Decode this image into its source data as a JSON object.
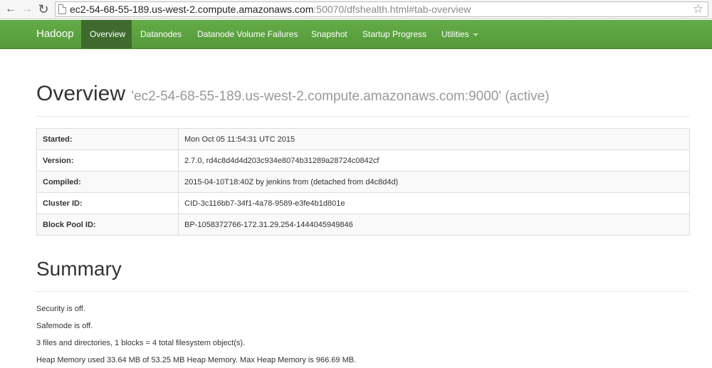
{
  "browser": {
    "url_host": "ec2-54-68-55-189.us-west-2.compute.amazonaws.com",
    "url_rest": ":50070/dfshealth.html#tab-overview"
  },
  "navbar": {
    "brand": "Hadoop",
    "items": [
      {
        "label": "Overview",
        "active": true
      },
      {
        "label": "Datanodes"
      },
      {
        "label": "Datanode Volume Failures"
      },
      {
        "label": "Snapshot"
      },
      {
        "label": "Startup Progress"
      },
      {
        "label": "Utilities"
      }
    ],
    "color": "#5da542",
    "active_color": "#3e6b2d"
  },
  "overview": {
    "title": "Overview",
    "subtitle": "'ec2-54-68-55-189.us-west-2.compute.amazonaws.com:9000' (active)",
    "rows": [
      {
        "key": "Started:",
        "value": "Mon Oct 05 11:54:31 UTC 2015"
      },
      {
        "key": "Version:",
        "value": "2.7.0, rd4c8d4d4d203c934e8074b31289a28724c0842cf"
      },
      {
        "key": "Compiled:",
        "value": "2015-04-10T18:40Z by jenkins from (detached from d4c8d4d)"
      },
      {
        "key": "Cluster ID:",
        "value": "CID-3c116bb7-34f1-4a78-9589-e3fe4b1d801e"
      },
      {
        "key": "Block Pool ID:",
        "value": "BP-1058372766-172.31.29.254-1444045949846"
      }
    ]
  },
  "summary": {
    "title": "Summary",
    "lines": [
      "Security is off.",
      "Safemode is off.",
      "3 files and directories, 1 blocks = 4 total filesystem object(s).",
      "Heap Memory used 33.64 MB of 53.25 MB Heap Memory. Max Heap Memory is 966.69 MB."
    ]
  }
}
